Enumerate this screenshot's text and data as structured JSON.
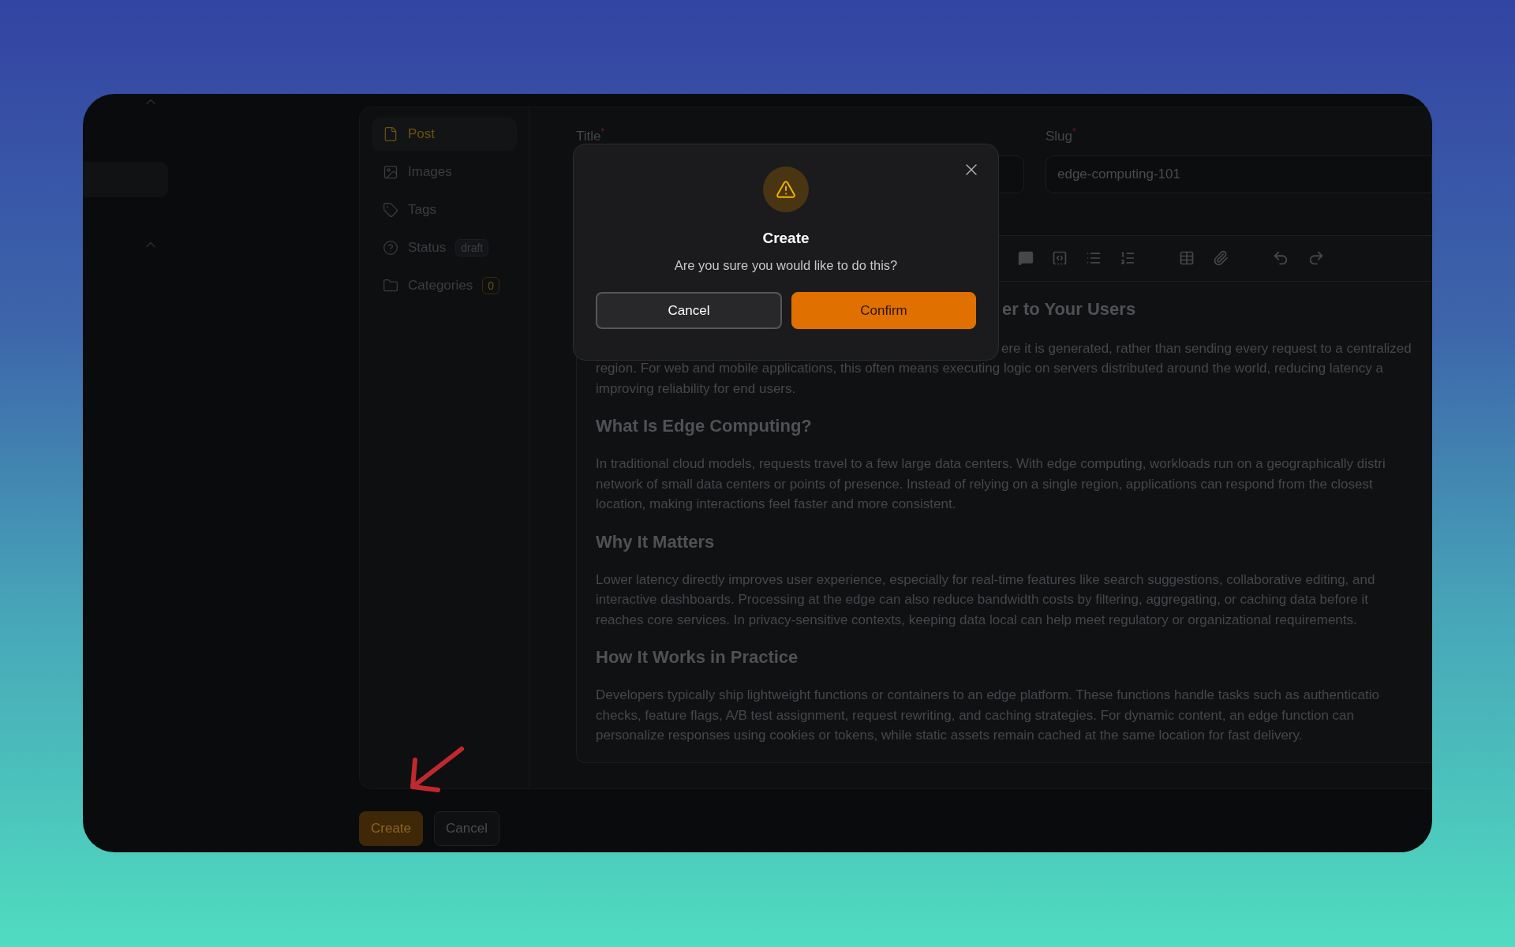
{
  "sidebar_nav": [
    {
      "label": "Post",
      "selected": true
    },
    {
      "label": "Images",
      "selected": false
    },
    {
      "label": "Tags",
      "selected": false
    },
    {
      "label": "Status",
      "selected": false,
      "badge": {
        "text": "draft",
        "kind": "neutral"
      }
    },
    {
      "label": "Categories",
      "selected": false,
      "badge": {
        "text": "0",
        "kind": "accent"
      }
    }
  ],
  "fields": [
    {
      "label": "Title",
      "asterisk": "*"
    },
    {
      "label": "Slug",
      "asterisk": "*",
      "value": "edge-computing-101"
    }
  ],
  "editor": {
    "blocks": [
      {
        "kind": "heading",
        "cut_left": true,
        "lines": [
          "er to Your Users"
        ]
      },
      {
        "kind": "paragraph",
        "cut_left": true,
        "lines": [
          "ere it is generated, rather than sending every request to a centralized"
        ]
      },
      {
        "kind": "paragraph",
        "cut_left": false,
        "lines": [
          "region. For web and mobile applications, this often means executing logic on servers distributed around the world, reducing latency a",
          "improving reliability for end users."
        ]
      },
      {
        "kind": "heading",
        "cut_left": false,
        "lines": [
          "What Is Edge Computing?"
        ]
      },
      {
        "kind": "paragraph",
        "cut_left": false,
        "lines": [
          "In traditional cloud models, requests travel to a few large data centers. With edge computing, workloads run on a geographically distri",
          "network of small data centers or points of presence. Instead of relying on a single region, applications can respond from the closest",
          "location, making interactions feel faster and more consistent."
        ]
      },
      {
        "kind": "heading",
        "cut_left": false,
        "lines": [
          "Why It Matters"
        ]
      },
      {
        "kind": "paragraph",
        "cut_left": false,
        "lines": [
          "Lower latency directly improves user experience, especially for real-time features like search suggestions, collaborative editing, and",
          "interactive dashboards. Processing at the edge can also reduce bandwidth costs by filtering, aggregating, or caching data before it",
          "reaches core services. In privacy-sensitive contexts, keeping data local can help meet regulatory or organizational requirements."
        ]
      },
      {
        "kind": "heading",
        "cut_left": false,
        "lines": [
          "How It Works in Practice"
        ]
      },
      {
        "kind": "paragraph",
        "cut_left": false,
        "lines": [
          "Developers typically ship lightweight functions or containers to an edge platform. These functions handle tasks such as authenticatio",
          "checks, feature flags, A/B test assignment, request rewriting, and caching strategies. For dynamic content, an edge function can",
          "personalize responses using cookies or tokens, while static assets remain cached at the same location for fast delivery."
        ]
      }
    ]
  },
  "footer_buttons": [
    {
      "label": "Create",
      "kind": "primary"
    },
    {
      "label": "Cancel",
      "kind": "secondary"
    }
  ],
  "dialog": {
    "title": "Create",
    "message": "Are you sure you would like to do this?",
    "buttons": [
      {
        "label": "Cancel",
        "kind": "secondary"
      },
      {
        "label": "Confirm",
        "kind": "primary"
      }
    ]
  }
}
